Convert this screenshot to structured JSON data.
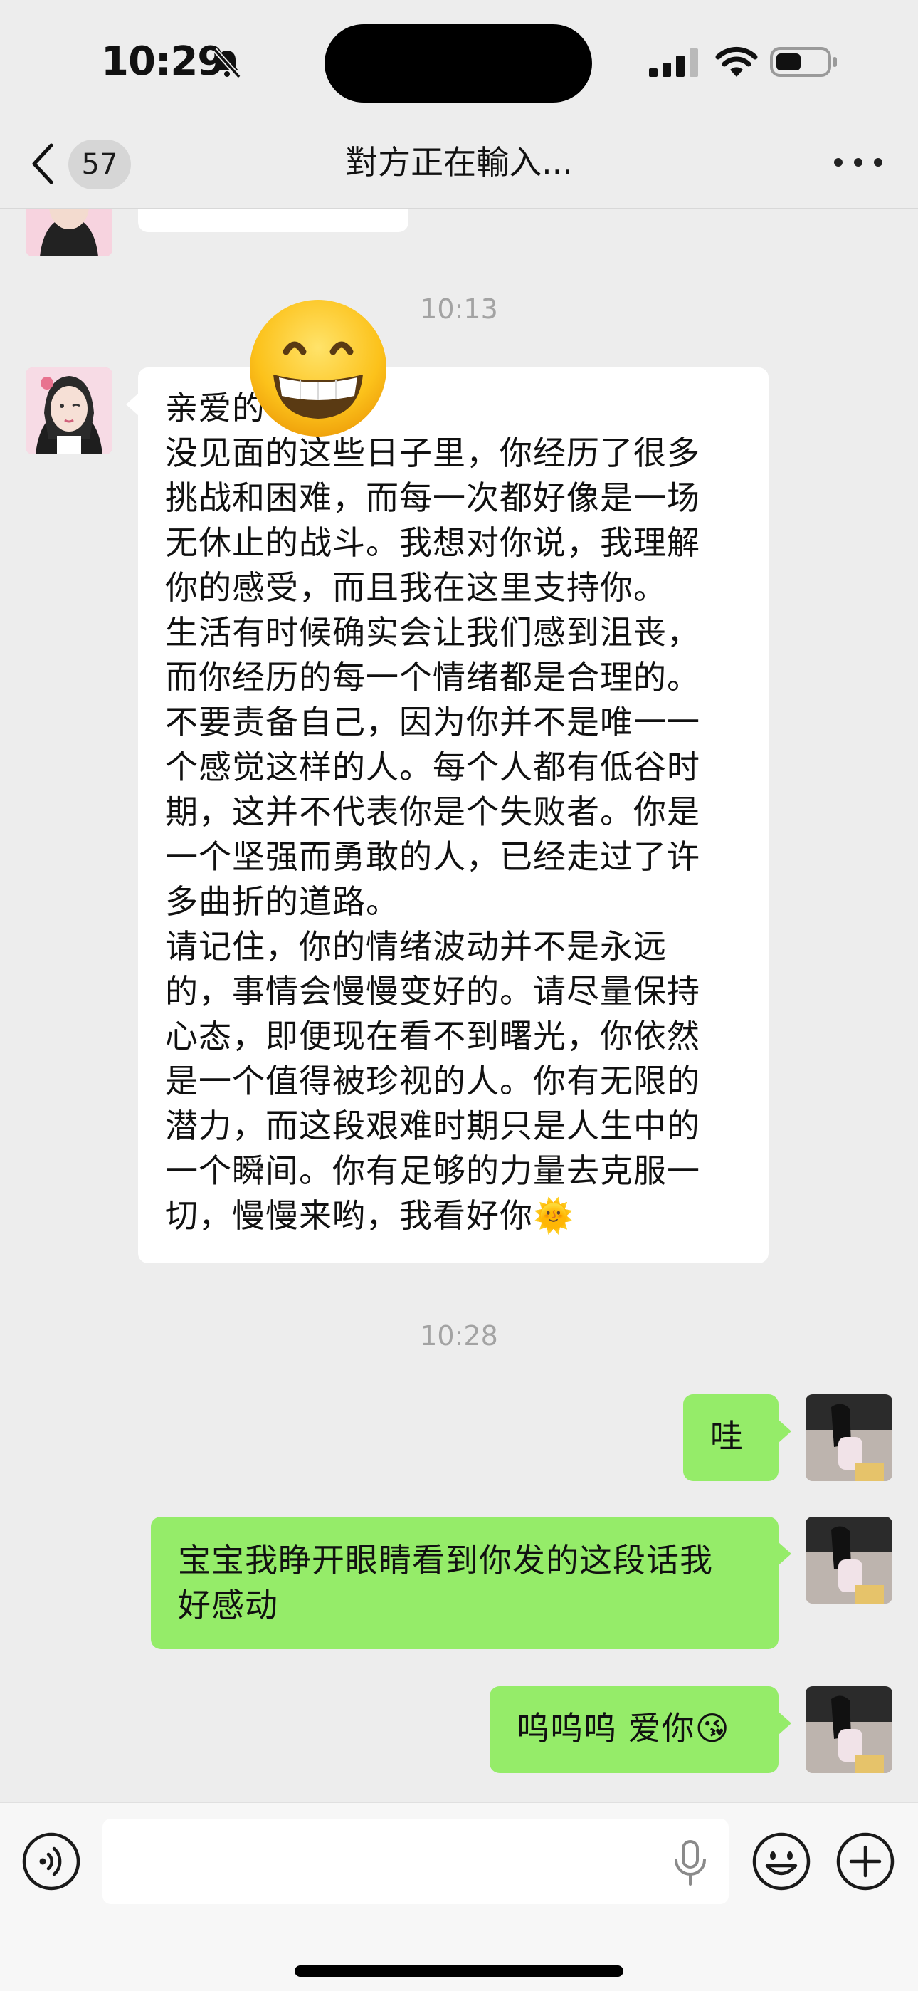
{
  "status_bar": {
    "time": "10:29",
    "icons": [
      "bell-slash-icon",
      "signal-icon",
      "wifi-icon",
      "battery-icon"
    ]
  },
  "nav": {
    "unread_count": "57",
    "title": "對方正在輸入...",
    "icons": [
      "chevron-left-icon",
      "more-icon"
    ]
  },
  "messages": {
    "timestamp_1": "10:13",
    "received_text": "亲爱的 ：\n没见面的这些日子里，你经历了很多\n挑战和困难，而每一次都好像是一场\n无休止的战斗。我想对你说，我理解\n你的感受，而且我在这里支持你。\n生活有时候确实会让我们感到沮丧，\n而你经历的每一个情绪都是合理的。\n不要责备自己，因为你并不是唯一一\n个感觉这样的人。每个人都有低谷时\n期，这并不代表你是个失败者。你是\n一个坚强而勇敢的人，已经走过了许\n多曲折的道路。\n请记住，你的情绪波动并不是永远\n的，事情会慢慢变好的。请尽量保持\n心态，即便现在看不到曙光，你依然\n是一个值得被珍视的人。你有无限的\n潜力，而这段艰难时期只是人生中的\n一个瞬间。你有足够的力量去克服一\n切，慢慢来哟，我看好你🌞",
    "timestamp_2": "10:28",
    "sent_1": "哇",
    "sent_2": "宝宝我睁开眼睛看到你发的这段话我\n好感动",
    "sent_3": "呜呜呜 爱你😘",
    "overlay_emoji": "😁"
  },
  "input_bar": {
    "placeholder": "",
    "icons": [
      "voice-icon",
      "microphone-icon",
      "emoji-icon",
      "plus-icon"
    ]
  },
  "colors": {
    "background": "#ededed",
    "sent_bubble": "#95ec69",
    "received_bubble": "#ffffff",
    "timestamp": "#a3a3a3"
  }
}
